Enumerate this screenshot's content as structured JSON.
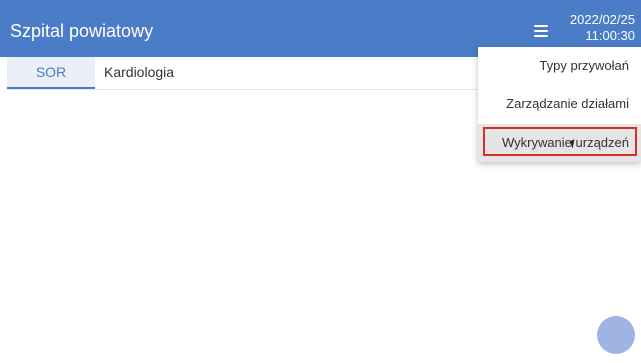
{
  "header": {
    "title": "Szpital powiatowy",
    "date": "2022/02/25",
    "time": "11:00:30",
    "menu_icon": "hamburger-menu-icon"
  },
  "tabs": [
    {
      "label": "SOR",
      "active": true
    },
    {
      "label": "Kardiologia",
      "active": false
    }
  ],
  "dropdown": {
    "items": [
      {
        "label": "Typy przywołań"
      },
      {
        "label": "Zarządzanie działami"
      },
      {
        "label": "Wykrywanie urządzeń",
        "highlighted": true
      }
    ]
  },
  "fab": {
    "icon": "circle-action-icon"
  },
  "colors": {
    "header_bg": "#4a7cc7",
    "active_tab_bg": "#eaeff8",
    "highlight_border": "#d32f2f",
    "fab": "#9fb4e3"
  }
}
